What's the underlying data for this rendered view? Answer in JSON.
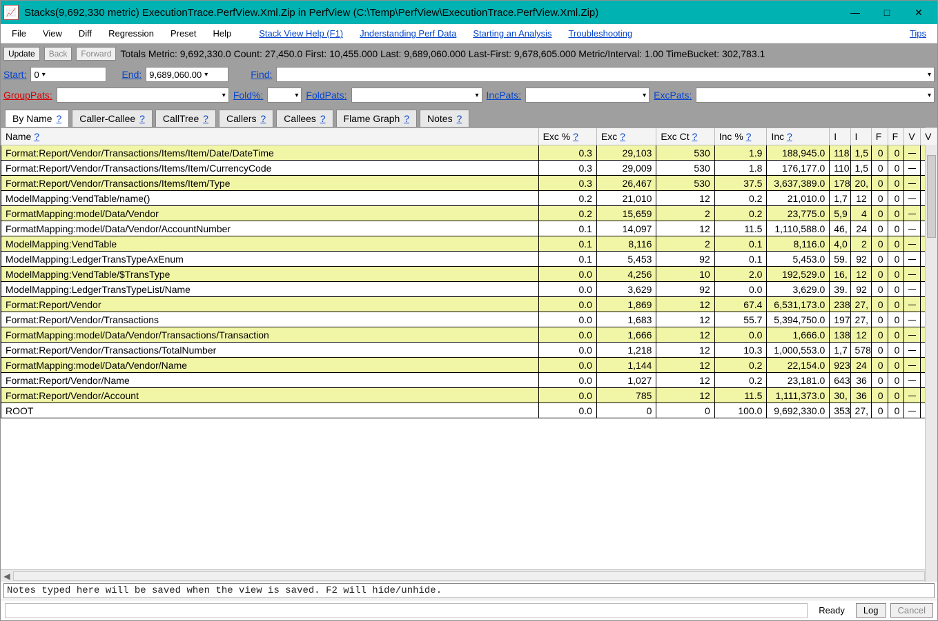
{
  "window": {
    "title": "Stacks(9,692,330 metric) ExecutionTrace.PerfView.Xml.Zip in PerfView (C:\\Temp\\PerfView\\ExecutionTrace.PerfView.Xml.Zip)",
    "icon_label": "📈"
  },
  "menu": {
    "items": [
      "File",
      "View",
      "Diff",
      "Regression",
      "Preset",
      "Help"
    ],
    "help_links": [
      "Stack View Help (F1)",
      "Jnderstanding Perf Data",
      "Starting an Analysis",
      "Troubleshooting",
      "Tips"
    ]
  },
  "toolbar1": {
    "update": "Update",
    "back": "Back",
    "forward": "Forward",
    "totals": "Totals Metric: 9,692,330.0   Count: 27,450.0   First: 10,455.000 Last: 9,689,060.000   Last-First: 9,678,605.000   Metric/Interval: 1.00   TimeBucket: 302,783.1"
  },
  "toolbar2": {
    "start_lbl": "Start:",
    "start_val": "0",
    "end_lbl": "End:",
    "end_val": "9,689,060.00",
    "find_lbl": "Find:",
    "find_val": ""
  },
  "toolbar3": {
    "grouppats_lbl": "GroupPats:",
    "grouppats_val": "",
    "foldpct_lbl": "Fold%:",
    "foldpct_val": "",
    "foldpats_lbl": "FoldPats:",
    "foldpats_val": "",
    "incpats_lbl": "IncPats:",
    "incpats_val": "",
    "excpats_lbl": "ExcPats:",
    "excpats_val": ""
  },
  "tabs": [
    {
      "label": "By Name",
      "q": "?",
      "active": true
    },
    {
      "label": "Caller-Callee",
      "q": "?",
      "active": false
    },
    {
      "label": "CallTree",
      "q": "?",
      "active": false
    },
    {
      "label": "Callers",
      "q": "?",
      "active": false
    },
    {
      "label": "Callees",
      "q": "?",
      "active": false
    },
    {
      "label": "Flame Graph",
      "q": "?",
      "active": false
    },
    {
      "label": "Notes",
      "q": "?",
      "active": false
    }
  ],
  "columns": [
    "Name",
    "Exc %",
    "Exc",
    "Exc Ct",
    "Inc %",
    "Inc",
    "I",
    "I",
    "F",
    "F",
    "V",
    "V"
  ],
  "column_q": "?",
  "rows": [
    {
      "alt": true,
      "name": "Format:Report/Vendor/Transactions/Items/Item/Date/DateTime",
      "excp": "0.3",
      "exc": "29,103",
      "excct": "530",
      "incp": "1.9",
      "inc": "188,945.0",
      "n1": "118",
      "n2": "1,5",
      "n3": "0",
      "n4": "0"
    },
    {
      "alt": false,
      "name": "Format:Report/Vendor/Transactions/Items/Item/CurrencyCode",
      "excp": "0.3",
      "exc": "29,009",
      "excct": "530",
      "incp": "1.8",
      "inc": "176,177.0",
      "n1": "110",
      "n2": "1,5",
      "n3": "0",
      "n4": "0"
    },
    {
      "alt": true,
      "name": "Format:Report/Vendor/Transactions/Items/Item/Type",
      "excp": "0.3",
      "exc": "26,467",
      "excct": "530",
      "incp": "37.5",
      "inc": "3,637,389.0",
      "n1": "178",
      "n2": "20,",
      "n3": "0",
      "n4": "0"
    },
    {
      "alt": false,
      "name": "ModelMapping:VendTable/name()",
      "excp": "0.2",
      "exc": "21,010",
      "excct": "12",
      "incp": "0.2",
      "inc": "21,010.0",
      "n1": "1,7",
      "n2": "12",
      "n3": "0",
      "n4": "0"
    },
    {
      "alt": true,
      "name": "FormatMapping:model/Data/Vendor",
      "excp": "0.2",
      "exc": "15,659",
      "excct": "2",
      "incp": "0.2",
      "inc": "23,775.0",
      "n1": "5,9",
      "n2": "4",
      "n3": "0",
      "n4": "0"
    },
    {
      "alt": false,
      "name": "FormatMapping:model/Data/Vendor/AccountNumber",
      "excp": "0.1",
      "exc": "14,097",
      "excct": "12",
      "incp": "11.5",
      "inc": "1,110,588.0",
      "n1": "46,",
      "n2": "24",
      "n3": "0",
      "n4": "0"
    },
    {
      "alt": true,
      "name": "ModelMapping:VendTable",
      "excp": "0.1",
      "exc": "8,116",
      "excct": "2",
      "incp": "0.1",
      "inc": "8,116.0",
      "n1": "4,0",
      "n2": "2",
      "n3": "0",
      "n4": "0"
    },
    {
      "alt": false,
      "name": "ModelMapping:LedgerTransTypeAxEnum",
      "excp": "0.1",
      "exc": "5,453",
      "excct": "92",
      "incp": "0.1",
      "inc": "5,453.0",
      "n1": "59.",
      "n2": "92",
      "n3": "0",
      "n4": "0"
    },
    {
      "alt": true,
      "name": "ModelMapping:VendTable/$TransType",
      "excp": "0.0",
      "exc": "4,256",
      "excct": "10",
      "incp": "2.0",
      "inc": "192,529.0",
      "n1": "16,",
      "n2": "12",
      "n3": "0",
      "n4": "0"
    },
    {
      "alt": false,
      "name": "ModelMapping:LedgerTransTypeList/Name",
      "excp": "0.0",
      "exc": "3,629",
      "excct": "92",
      "incp": "0.0",
      "inc": "3,629.0",
      "n1": "39.",
      "n2": "92",
      "n3": "0",
      "n4": "0"
    },
    {
      "alt": true,
      "name": "Format:Report/Vendor",
      "excp": "0.0",
      "exc": "1,869",
      "excct": "12",
      "incp": "67.4",
      "inc": "6,531,173.0",
      "n1": "238",
      "n2": "27,",
      "n3": "0",
      "n4": "0"
    },
    {
      "alt": false,
      "name": "Format:Report/Vendor/Transactions",
      "excp": "0.0",
      "exc": "1,683",
      "excct": "12",
      "incp": "55.7",
      "inc": "5,394,750.0",
      "n1": "197",
      "n2": "27,",
      "n3": "0",
      "n4": "0"
    },
    {
      "alt": true,
      "name": "FormatMapping:model/Data/Vendor/Transactions/Transaction",
      "excp": "0.0",
      "exc": "1,666",
      "excct": "12",
      "incp": "0.0",
      "inc": "1,666.0",
      "n1": "138",
      "n2": "12",
      "n3": "0",
      "n4": "0"
    },
    {
      "alt": false,
      "name": "Format:Report/Vendor/Transactions/TotalNumber",
      "excp": "0.0",
      "exc": "1,218",
      "excct": "12",
      "incp": "10.3",
      "inc": "1,000,553.0",
      "n1": "1,7",
      "n2": "578",
      "n3": "0",
      "n4": "0"
    },
    {
      "alt": true,
      "name": "FormatMapping:model/Data/Vendor/Name",
      "excp": "0.0",
      "exc": "1,144",
      "excct": "12",
      "incp": "0.2",
      "inc": "22,154.0",
      "n1": "923",
      "n2": "24",
      "n3": "0",
      "n4": "0"
    },
    {
      "alt": false,
      "name": "Format:Report/Vendor/Name",
      "excp": "0.0",
      "exc": "1,027",
      "excct": "12",
      "incp": "0.2",
      "inc": "23,181.0",
      "n1": "643",
      "n2": "36",
      "n3": "0",
      "n4": "0"
    },
    {
      "alt": true,
      "name": "Format:Report/Vendor/Account",
      "excp": "0.0",
      "exc": "785",
      "excct": "12",
      "incp": "11.5",
      "inc": "1,111,373.0",
      "n1": "30,",
      "n2": "36",
      "n3": "0",
      "n4": "0"
    },
    {
      "alt": false,
      "name": "ROOT",
      "excp": "0.0",
      "exc": "0",
      "excct": "0",
      "incp": "100.0",
      "inc": "9,692,330.0",
      "n1": "353",
      "n2": "27,",
      "n3": "0",
      "n4": "0"
    }
  ],
  "notes_placeholder": "Notes typed here will be saved when the view is saved. F2 will hide/unhide.",
  "status": {
    "ready": "Ready",
    "log": "Log",
    "cancel": "Cancel"
  }
}
